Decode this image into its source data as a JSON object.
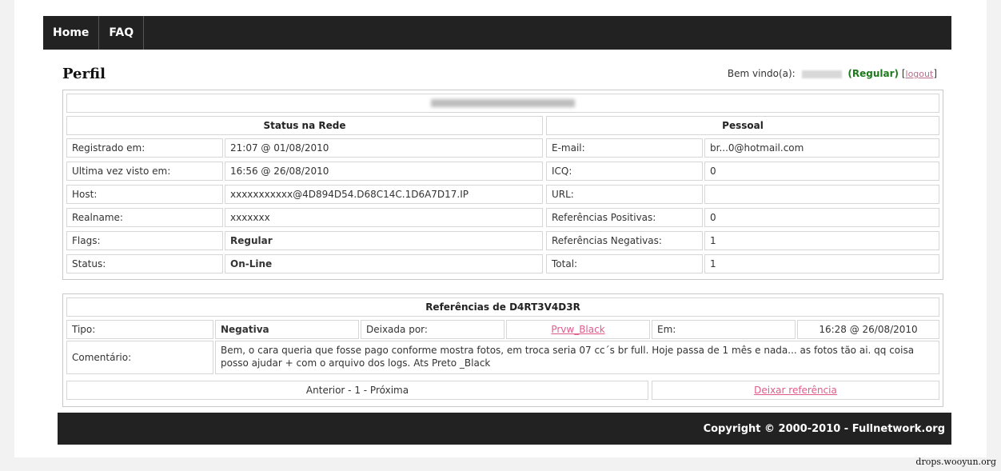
{
  "nav": {
    "items": [
      "Home",
      "FAQ"
    ]
  },
  "header": {
    "title": "Perfil",
    "welcome_prefix": "Bem vindo(a):",
    "user_level": "(Regular)",
    "logout_label": "logout",
    "bracket_open": "[",
    "bracket_close": "]"
  },
  "profile": {
    "status_heading": "Status na Rede",
    "personal_heading": "Pessoal",
    "rows": [
      {
        "label": "Registrado em:",
        "value": "21:07 @ 01/08/2010",
        "p_label": "E-mail:",
        "p_value": "br...0@hotmail.com"
      },
      {
        "label": "Ultima vez visto em:",
        "value": "16:56 @ 26/08/2010",
        "p_label": "ICQ:",
        "p_value": "0"
      },
      {
        "label": "Host:",
        "value": "xxxxxxxxxxx@4D894D54.D68C14C.1D6A7D17.IP",
        "p_label": "URL:",
        "p_value": ""
      },
      {
        "label": "Realname:",
        "value": "xxxxxxx",
        "p_label": "Referências Positivas:",
        "p_value": "0"
      },
      {
        "label": "Flags:",
        "value": "Regular",
        "p_label": "Referências Negativas:",
        "p_value": "1"
      },
      {
        "label": "Status:",
        "value": "On-Line",
        "p_label": "Total:",
        "p_value": "1"
      }
    ]
  },
  "references": {
    "heading": "Referências de D4RT3V4D3R",
    "tipo_label": "Tipo:",
    "tipo_value": "Negativa",
    "left_by_label": "Deixada por:",
    "left_by_value": "Prvw_Black",
    "em_label": "Em:",
    "em_value": "16:28 @ 26/08/2010",
    "comment_label": "Comentário:",
    "comment_text": "Bem, o cara queria que fosse pago conforme mostra fotos, em troca seria 07 cc´s br full. Hoje passa de 1 mês e nada... as fotos tão ai. qq coisa posso ajudar + com o arquivo dos logs. Ats Preto _Black",
    "pagination": "Anterior - 1 - Próxima",
    "leave_ref": "Deixar referência"
  },
  "footer": {
    "copyright": "Copyright © 2000-2010 - Fullnetwork.org"
  },
  "watermark": "drops.wooyun.org",
  "colors": {
    "green": "#1c7a1c",
    "red": "#c8102e",
    "nav_bg": "#222222"
  }
}
